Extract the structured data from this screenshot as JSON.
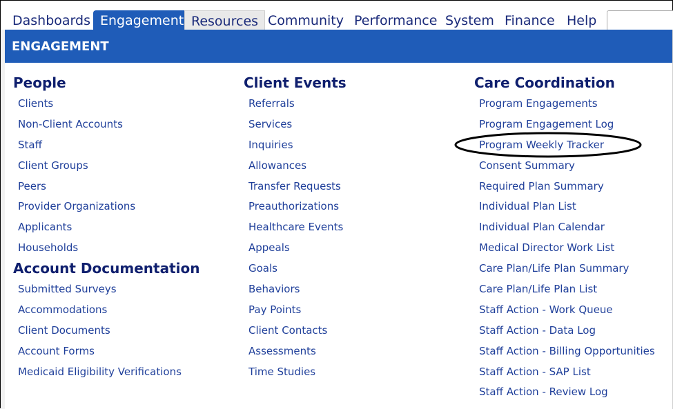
{
  "topnav": {
    "tabs": [
      {
        "label": "Dashboards",
        "id": "dashboards"
      },
      {
        "label": "Engagement",
        "id": "engagement",
        "active": true
      },
      {
        "label": "Resources",
        "id": "resources"
      },
      {
        "label": "Community",
        "id": "community"
      },
      {
        "label": "Performance",
        "id": "performance"
      },
      {
        "label": "System",
        "id": "system"
      },
      {
        "label": "Finance",
        "id": "finance"
      },
      {
        "label": "Help",
        "id": "help"
      }
    ]
  },
  "panel": {
    "title": "ENGAGEMENT",
    "columns": [
      {
        "sections": [
          {
            "heading": "People",
            "items": [
              "Clients",
              "Non-Client Accounts",
              "Staff",
              "Client Groups",
              "Peers",
              "Provider Organizations",
              "Applicants",
              "Households"
            ]
          },
          {
            "heading": "Account Documentation",
            "items": [
              "Submitted Surveys",
              "Accommodations",
              "Client Documents",
              "Account Forms",
              "Medicaid Eligibility Verifications"
            ]
          }
        ]
      },
      {
        "sections": [
          {
            "heading": "Client Events",
            "items": [
              "Referrals",
              "Services",
              "Inquiries",
              "Allowances",
              "Transfer Requests",
              "Preauthorizations",
              "Healthcare Events",
              "Appeals",
              "Goals",
              "Behaviors",
              "Pay Points",
              "Client Contacts",
              "Assessments",
              "Time Studies"
            ]
          }
        ]
      },
      {
        "sections": [
          {
            "heading": "Care Coordination",
            "items": [
              "Program Engagements",
              "Program Engagement Log",
              "Program Weekly Tracker",
              "Consent Summary",
              "Required Plan Summary",
              "Individual Plan List",
              "Individual Plan Calendar",
              "Medical Director Work List",
              "Care Plan/Life Plan Summary",
              "Care Plan/Life Plan List",
              "Staff Action - Work Queue",
              "Staff Action - Data Log",
              "Staff Action - Billing Opportunities",
              "Staff Action - SAP List",
              "Staff Action - Review Log"
            ]
          }
        ]
      }
    ]
  },
  "colors": {
    "header_blue": "#1f5cb8",
    "heading_navy": "#0f1f6e",
    "link_blue": "#1f3f9a"
  }
}
